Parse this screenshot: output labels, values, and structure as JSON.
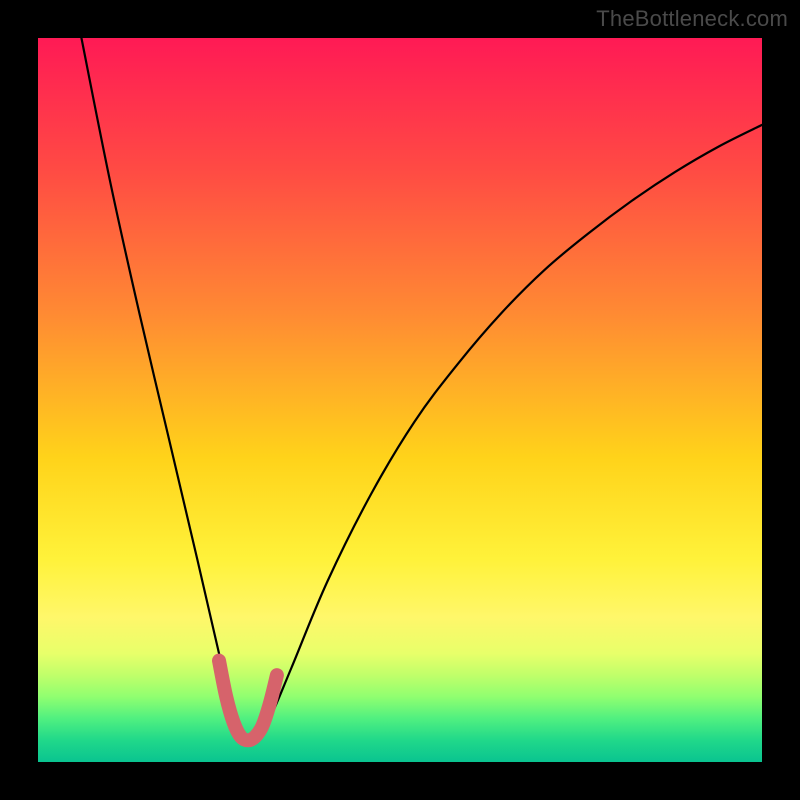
{
  "watermark": "TheBottleneck.com",
  "chart_data": {
    "type": "line",
    "title": "",
    "xlabel": "",
    "ylabel": "",
    "xlim": [
      0,
      100
    ],
    "ylim": [
      0,
      100
    ],
    "series": [
      {
        "name": "bottleneck-curve",
        "x": [
          6,
          10,
          14,
          18,
          22,
          25,
          27,
          28.5,
          30,
          32,
          35,
          40,
          46,
          52,
          58,
          64,
          70,
          76,
          82,
          88,
          94,
          100
        ],
        "y": [
          100,
          80,
          62,
          45,
          28,
          15,
          7,
          3,
          3,
          6,
          13,
          25,
          37,
          47,
          55,
          62,
          68,
          73,
          77.5,
          81.5,
          85,
          88
        ]
      },
      {
        "name": "trough-marker",
        "x": [
          25,
          26,
          27,
          28,
          29,
          30,
          31,
          32,
          33
        ],
        "y": [
          14,
          9,
          5.5,
          3.5,
          3,
          3.5,
          5,
          8,
          12
        ]
      }
    ],
    "gradient_stops": [
      {
        "pos": 0,
        "color": "#ff1a55"
      },
      {
        "pos": 18,
        "color": "#ff4a44"
      },
      {
        "pos": 38,
        "color": "#ff8a33"
      },
      {
        "pos": 58,
        "color": "#ffd31a"
      },
      {
        "pos": 72,
        "color": "#fff23a"
      },
      {
        "pos": 80,
        "color": "#fff76a"
      },
      {
        "pos": 85,
        "color": "#e8ff6a"
      },
      {
        "pos": 88,
        "color": "#c0ff6a"
      },
      {
        "pos": 91,
        "color": "#90ff70"
      },
      {
        "pos": 94,
        "color": "#50f080"
      },
      {
        "pos": 97,
        "color": "#20d88a"
      },
      {
        "pos": 100,
        "color": "#0ac490"
      }
    ],
    "colors": {
      "curve": "#000000",
      "marker": "#d6636b",
      "frame": "#000000"
    }
  }
}
